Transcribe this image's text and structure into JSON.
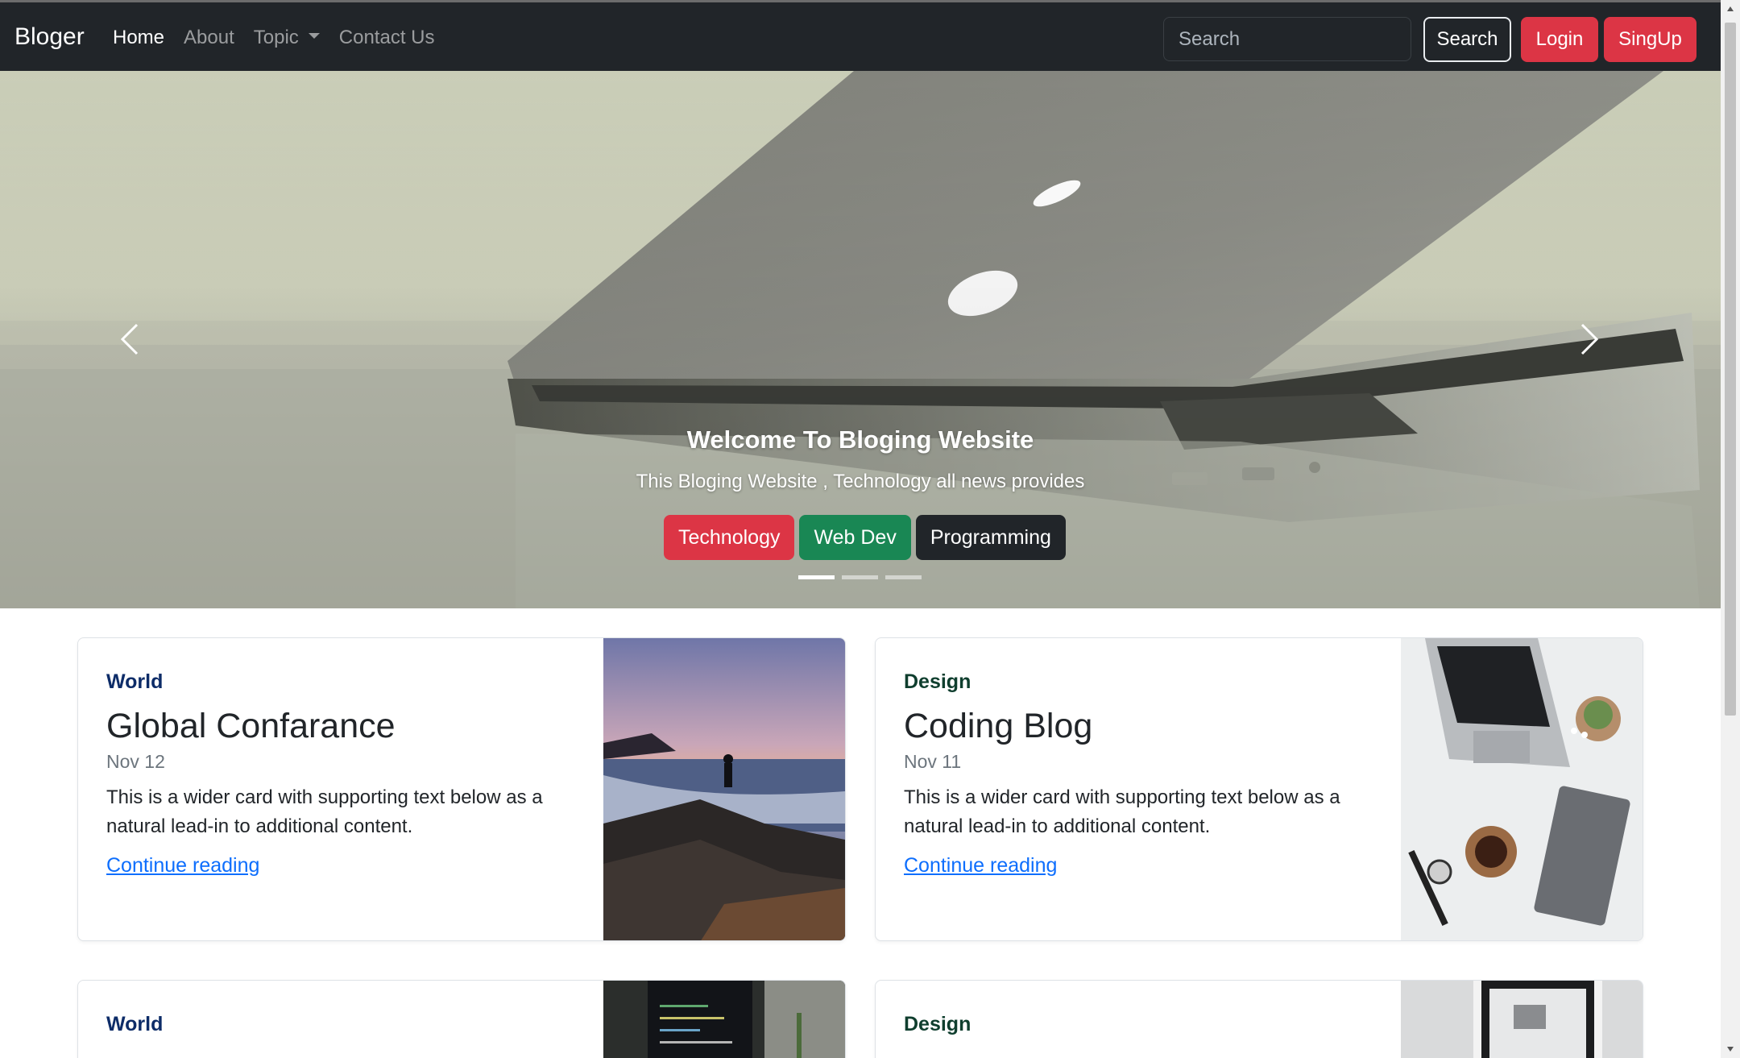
{
  "navbar": {
    "brand": "Bloger",
    "links": [
      {
        "label": "Home"
      },
      {
        "label": "About"
      },
      {
        "label": "Topic"
      },
      {
        "label": "Contact Us"
      }
    ],
    "search_placeholder": "Search",
    "search_button": "Search",
    "login_button": "Login",
    "signup_button": "SingUp"
  },
  "hero": {
    "title": "Welcome To Bloging Website",
    "subtitle": "This Bloging Website , Technology all news provides",
    "tags": [
      "Technology",
      "Web Dev",
      "Programming"
    ],
    "active_slide": 1,
    "slide_count": 3
  },
  "cards": [
    {
      "category": "World",
      "title": "Global Confarance",
      "date": "Nov 12",
      "text": "This is a wider card with supporting text below as a natural lead-in to additional content.",
      "link": "Continue reading"
    },
    {
      "category": "Design",
      "title": "Coding Blog",
      "date": "Nov 11",
      "text": "This is a wider card with supporting text below as a natural lead-in to additional content.",
      "link": "Continue reading"
    },
    {
      "category": "World"
    },
    {
      "category": "Design"
    }
  ],
  "colors": {
    "navbar": "#212529",
    "danger": "#dc3545",
    "success": "#198754",
    "link": "#0d6efd"
  }
}
